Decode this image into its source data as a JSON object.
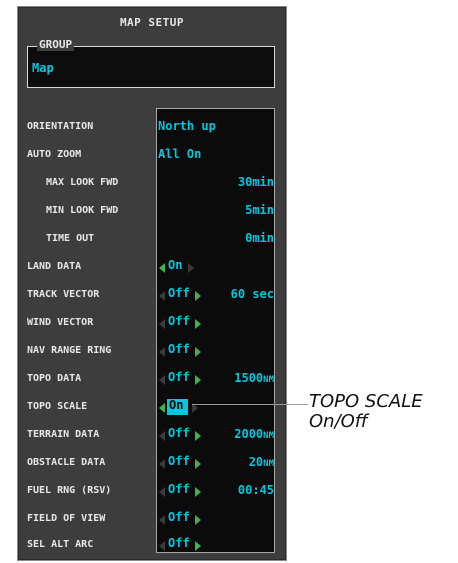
{
  "title": "MAP SETUP",
  "group": {
    "legend": "GROUP",
    "value": "Map"
  },
  "rows": [
    {
      "label": "ORIENTATION",
      "value": "North up"
    },
    {
      "label": "AUTO ZOOM",
      "value": "All On"
    },
    {
      "label": "MAX LOOK FWD",
      "value": "30min"
    },
    {
      "label": "MIN LOOK FWD",
      "value": "5min"
    },
    {
      "label": "TIME OUT",
      "value": "0min"
    },
    {
      "label": "LAND DATA",
      "value": "On"
    },
    {
      "label": "TRACK VECTOR",
      "value": "Off",
      "value2": "60 sec"
    },
    {
      "label": "WIND VECTOR",
      "value": "Off"
    },
    {
      "label": "NAV RANGE RING",
      "value": "Off"
    },
    {
      "label": "TOPO DATA",
      "value": "Off",
      "value2": "1500",
      "unit": "NM"
    },
    {
      "label": "TOPO SCALE",
      "value": "On"
    },
    {
      "label": "TERRAIN DATA",
      "value": "Off",
      "value2": "2000",
      "unit": "NM"
    },
    {
      "label": "OBSTACLE DATA",
      "value": "Off",
      "value2": "20",
      "unit": "NM"
    },
    {
      "label": "FUEL RNG (RSV)",
      "value": "Off",
      "value2": "00:45"
    },
    {
      "label": "FIELD OF VIEW",
      "value": "Off"
    },
    {
      "label": "SEL ALT ARC",
      "value": "Off"
    }
  ],
  "callout": {
    "line1": "TOPO SCALE",
    "line2": "On/Off"
  },
  "colors": {
    "panel": "#3d3d3d",
    "value_text": "#00c8e0",
    "arrow_active": "#3fb34f",
    "label_text": "#e8e8e8"
  }
}
